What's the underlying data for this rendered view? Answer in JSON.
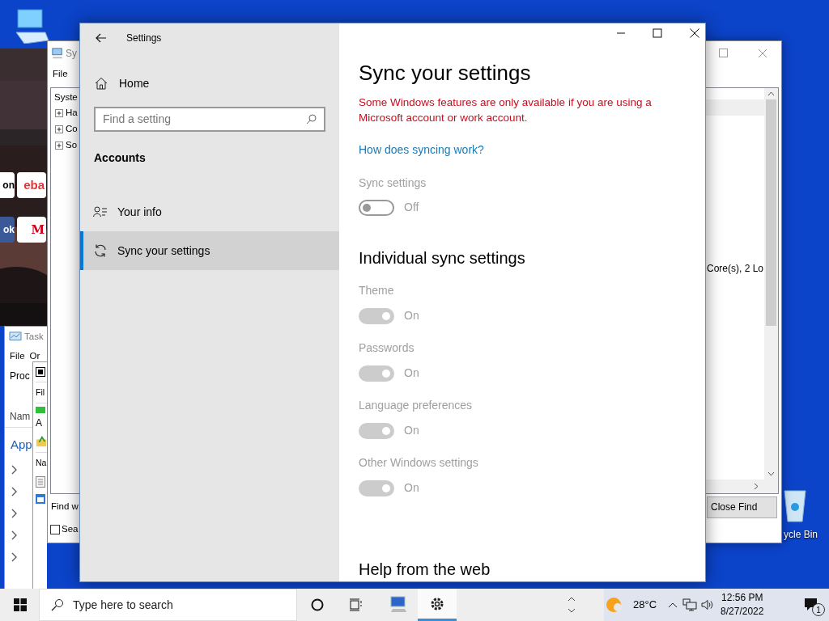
{
  "desktop": {
    "icons": [
      {
        "kind": "computer"
      },
      {
        "kind": "recycle",
        "label": "ycle Bin"
      }
    ]
  },
  "browser_window": {
    "tiles": [
      {
        "label": "on",
        "kind": "light"
      },
      {
        "label": "eba",
        "kind": "ebay"
      },
      {
        "label": "ok",
        "kind": "blue"
      },
      {
        "label": "M",
        "kind": "red"
      }
    ]
  },
  "task_manager": {
    "title": "Task",
    "menu": [
      "File",
      "Or"
    ],
    "tab": "Proc",
    "column": "Nam",
    "group": "App"
  },
  "small_window": {
    "menu": "Fil",
    "item": "A",
    "column": "Na"
  },
  "system_information": {
    "title": "Sy",
    "menu": [
      "File"
    ],
    "tree": [
      {
        "label": "Syste",
        "children": [
          {
            "label": "Ha",
            "expanded": false
          },
          {
            "label": "Co",
            "expanded": false
          },
          {
            "label": "So",
            "expanded": false
          }
        ]
      }
    ],
    "detail_text": "Core(s), 2 Lo",
    "find_label": "Find w",
    "search_option": {
      "label": "Sea",
      "checked": false
    },
    "close_find": "Close Find"
  },
  "settings": {
    "title": "Settings",
    "nav": {
      "home": "Home",
      "search_placeholder": "Find a setting",
      "section": "Accounts",
      "items": [
        {
          "label": "Your info",
          "selected": false
        },
        {
          "label": "Sync your settings",
          "selected": true
        }
      ]
    },
    "page": {
      "title": "Sync your settings",
      "warning": "Some Windows features are only available if you are using a Microsoft account or work account.",
      "link": "How does syncing work?",
      "sync": {
        "label": "Sync settings",
        "on": false,
        "disabled": true,
        "state_text": "Off"
      },
      "individual_title": "Individual sync settings",
      "toggles": [
        {
          "label": "Theme",
          "on": true,
          "disabled": true,
          "state_text": "On"
        },
        {
          "label": "Passwords",
          "on": true,
          "disabled": true,
          "state_text": "On"
        },
        {
          "label": "Language preferences",
          "on": true,
          "disabled": true,
          "state_text": "On"
        },
        {
          "label": "Other Windows settings",
          "on": true,
          "disabled": true,
          "state_text": "On"
        }
      ],
      "help_title": "Help from the web"
    }
  },
  "taskbar": {
    "search_placeholder": "Type here to search",
    "apps": [
      {
        "kind": "sysinfo",
        "active": false
      },
      {
        "kind": "settings",
        "active": true
      }
    ],
    "weather": "28°C",
    "time": "12:56 PM",
    "date": "8/27/2022",
    "notifications": "1"
  }
}
